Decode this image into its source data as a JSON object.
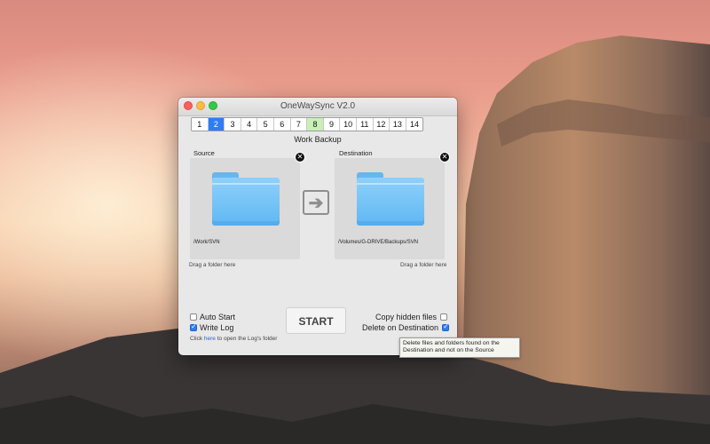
{
  "window": {
    "title": "OneWaySync V2.0"
  },
  "tabs": [
    "1",
    "2",
    "3",
    "4",
    "5",
    "6",
    "7",
    "8",
    "9",
    "10",
    "11",
    "12",
    "13",
    "14"
  ],
  "active_tab": "2",
  "highlighted_tab": "8",
  "profile_name": "Work Backup",
  "source": {
    "label": "Source",
    "path": "/Work/SVN",
    "hint": "Drag a folder here"
  },
  "destination": {
    "label": "Destination",
    "path": "/Volumes/G-DRIVE/Backups/SVN",
    "hint": "Drag a folder here"
  },
  "options": {
    "auto_start": {
      "label": "Auto Start",
      "checked": false
    },
    "write_log": {
      "label": "Write Log",
      "checked": true
    },
    "copy_hidden": {
      "label": "Copy hidden files",
      "checked": false
    },
    "delete_dest": {
      "label": "Delete on Destination",
      "checked": true
    }
  },
  "log_hint": {
    "prefix": "Click ",
    "link": "here",
    "suffix": " to open the Log's folder"
  },
  "start_label": "START",
  "tooltip": "Delete files and folders found on the Destination and not on the Source",
  "icons": {
    "remove": "close-circle-icon",
    "arrow": "arrow-right-icon",
    "folder": "folder-icon"
  },
  "colors": {
    "accent": "#2f7cf6",
    "highlight_tab": "#c8f0b5",
    "folder": "#5fb8f3"
  }
}
